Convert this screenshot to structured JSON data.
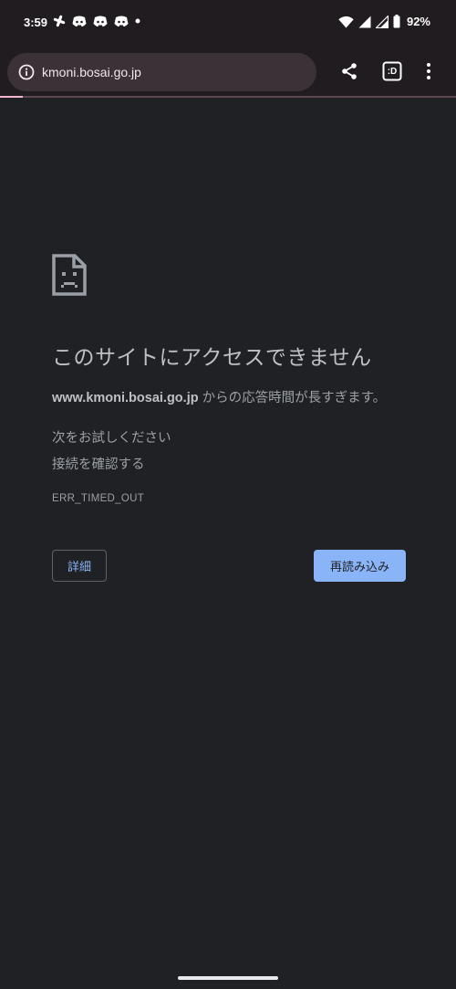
{
  "status_bar": {
    "time": "3:59",
    "notification_icons": [
      "slack-icon",
      "discord-icon",
      "discord-icon",
      "discord-icon",
      "dot-icon"
    ],
    "right_icons": [
      "wifi-icon",
      "signal-icon",
      "signal-icon",
      "battery-icon"
    ],
    "battery": "92%"
  },
  "toolbar": {
    "url": "kmoni.bosai.go.jp",
    "page_info_icon": "info-icon",
    "share_icon": "share-icon",
    "tab_switcher_label": ":D",
    "menu_icon": "more-vert-icon",
    "load_progress": 0.05,
    "progress_color": "#f5b5d0"
  },
  "error_page": {
    "icon": "sad-page-icon",
    "title": "このサイトにアクセスできません",
    "host": "www.kmoni.bosai.go.jp",
    "description_suffix": " からの応答時間が長すぎます。",
    "suggestions_heading": "次をお試しください",
    "suggestions": [
      "接続を確認する"
    ],
    "error_code": "ERR_TIMED_OUT",
    "details_button": "詳細",
    "reload_button": "再読み込み",
    "accent_color": "#8ab4f8"
  }
}
